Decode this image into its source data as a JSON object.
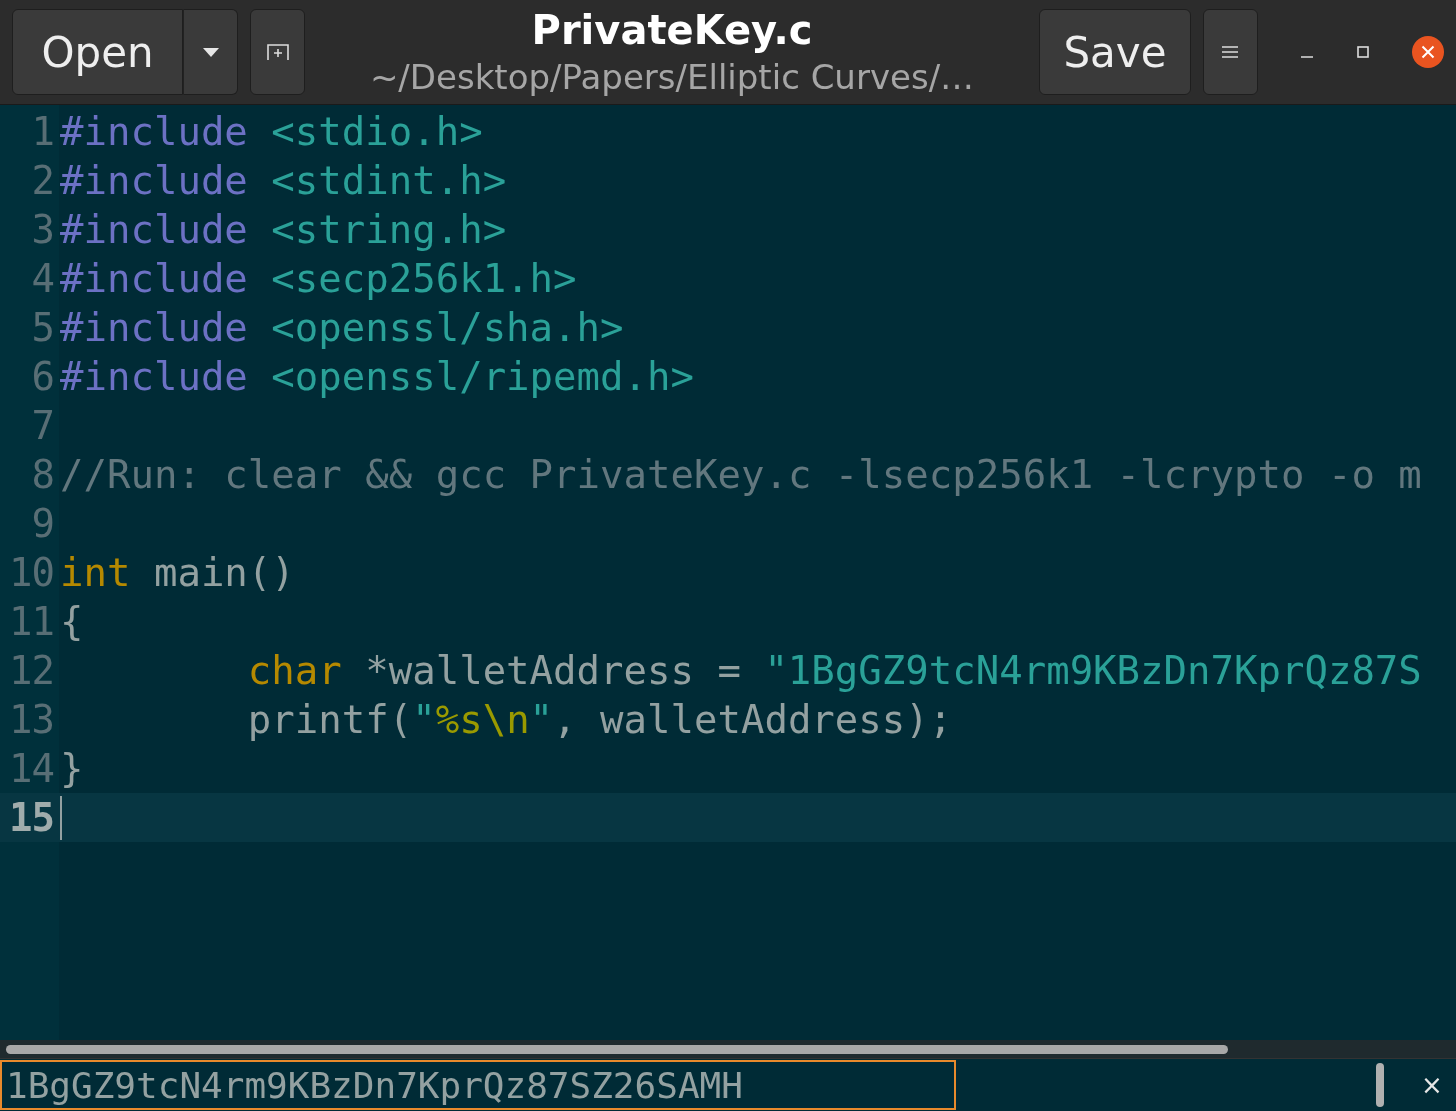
{
  "header": {
    "open_label": "Open",
    "title": "PrivateKey.c",
    "subtitle": "~/Desktop/Papers/Elliptic Curves/…",
    "save_label": "Save"
  },
  "lines": [
    {
      "number": "1",
      "current": false,
      "indented": false,
      "tokens": [
        {
          "kind": "directive",
          "text": "#include"
        },
        {
          "kind": "string",
          "text": " <stdio.h>"
        }
      ]
    },
    {
      "number": "2",
      "current": false,
      "indented": false,
      "tokens": [
        {
          "kind": "directive",
          "text": "#include"
        },
        {
          "kind": "string",
          "text": " <stdint.h>"
        }
      ]
    },
    {
      "number": "3",
      "current": false,
      "indented": false,
      "tokens": [
        {
          "kind": "directive",
          "text": "#include"
        },
        {
          "kind": "string",
          "text": " <string.h>"
        }
      ]
    },
    {
      "number": "4",
      "current": false,
      "indented": false,
      "tokens": [
        {
          "kind": "directive",
          "text": "#include"
        },
        {
          "kind": "string",
          "text": " <secp256k1.h>"
        }
      ]
    },
    {
      "number": "5",
      "current": false,
      "indented": false,
      "tokens": [
        {
          "kind": "directive",
          "text": "#include"
        },
        {
          "kind": "string",
          "text": " <openssl/sha.h>"
        }
      ]
    },
    {
      "number": "6",
      "current": false,
      "indented": false,
      "tokens": [
        {
          "kind": "directive",
          "text": "#include"
        },
        {
          "kind": "string",
          "text": " <openssl/ripemd.h>"
        }
      ]
    },
    {
      "number": "7",
      "current": false
    },
    {
      "number": "8",
      "current": false,
      "indented": false,
      "tokens": [
        {
          "kind": "comment",
          "text": "//Run: clear && gcc PrivateKey.c -lsecp256k1 -lcrypto -o m"
        }
      ]
    },
    {
      "number": "9",
      "current": false
    },
    {
      "number": "10",
      "current": false,
      "indented": false,
      "tokens": [
        {
          "kind": "type",
          "text": "int"
        },
        {
          "kind": "plain",
          "text": " main()"
        }
      ]
    },
    {
      "number": "11",
      "current": false,
      "indented": false,
      "tokens": [
        {
          "kind": "plain",
          "text": "{"
        }
      ]
    },
    {
      "number": "12",
      "current": false,
      "indented": true,
      "tokens": [
        {
          "kind": "type",
          "text": "char"
        },
        {
          "kind": "plain",
          "text": " *walletAddress = "
        },
        {
          "kind": "string",
          "text": "\"1BgGZ9tcN4rm9KBzDn7KprQz87S"
        }
      ]
    },
    {
      "number": "13",
      "current": false,
      "indented": true,
      "tokens": [
        {
          "kind": "plain",
          "text": "printf("
        },
        {
          "kind": "string",
          "text": "\""
        },
        {
          "kind": "escape",
          "text": "%s\\n"
        },
        {
          "kind": "string",
          "text": "\""
        },
        {
          "kind": "plain",
          "text": ", walletAddress);"
        }
      ]
    },
    {
      "number": "14",
      "current": false,
      "indented": false,
      "tokens": [
        {
          "kind": "plain",
          "text": "}"
        }
      ]
    },
    {
      "number": "15",
      "current": true
    }
  ],
  "output": {
    "value": "1BgGZ9tcN4rm9KBzDn7KprQz87SZ26SAMH",
    "close": "×"
  }
}
